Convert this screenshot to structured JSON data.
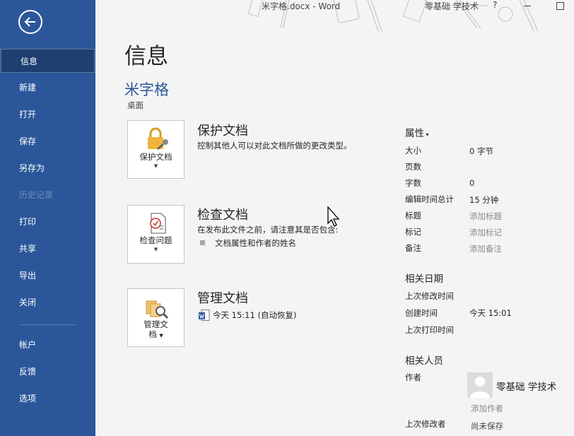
{
  "sidebar": {
    "items": [
      {
        "label": "信息"
      },
      {
        "label": "新建"
      },
      {
        "label": "打开"
      },
      {
        "label": "保存"
      },
      {
        "label": "另存为"
      },
      {
        "label": "历史记录"
      },
      {
        "label": "打印"
      },
      {
        "label": "共享"
      },
      {
        "label": "导出"
      },
      {
        "label": "关闭"
      },
      {
        "label": "帐户"
      },
      {
        "label": "反馈"
      },
      {
        "label": "选项"
      }
    ]
  },
  "titlebar": {
    "title": "米字格.docx  -  Word",
    "account": "零基础 学技术",
    "help": "?"
  },
  "page": {
    "title": "信息",
    "doc_name": "米字格",
    "doc_location": "桌面"
  },
  "sections": {
    "protect": {
      "tile_label": "保护文档",
      "heading": "保护文档",
      "desc": "控制其他人可以对此文档所做的更改类型。"
    },
    "inspect": {
      "tile_label": "检查问题",
      "heading": "检查文档",
      "desc": "在发布此文件之前，请注意其是否包含:",
      "bullet": "文档属性和作者的姓名"
    },
    "manage": {
      "tile_label_1": "管理文",
      "tile_label_2": "档",
      "heading": "管理文档",
      "version": "今天 15:11 (自动恢复)"
    }
  },
  "properties": {
    "heading": "属性",
    "rows": [
      {
        "label": "大小",
        "value": "0 字节",
        "hint": false
      },
      {
        "label": "页数",
        "value": "",
        "hint": false
      },
      {
        "label": "字数",
        "value": "0",
        "hint": false
      },
      {
        "label": "编辑时间总计",
        "value": "15 分钟",
        "hint": false
      },
      {
        "label": "标题",
        "value": "添加标题",
        "hint": true
      },
      {
        "label": "标记",
        "value": "添加标记",
        "hint": true
      },
      {
        "label": "备注",
        "value": "添加备注",
        "hint": true
      }
    ]
  },
  "dates": {
    "heading": "相关日期",
    "last_modified_label": "上次修改时间",
    "created_label": "创建时间",
    "created_value": "今天 15:01",
    "last_printed_label": "上次打印时间"
  },
  "people": {
    "heading": "相关人员",
    "author_label": "作者",
    "author_name": "零基础 学技术",
    "add_author": "添加作者",
    "last_modified_by_label": "上次修改者",
    "last_modified_by_value": "尚未保存"
  },
  "colors": {
    "sidebar": "#2b579a",
    "sidebar_active": "#1e3f70",
    "link": "#2b579a"
  }
}
